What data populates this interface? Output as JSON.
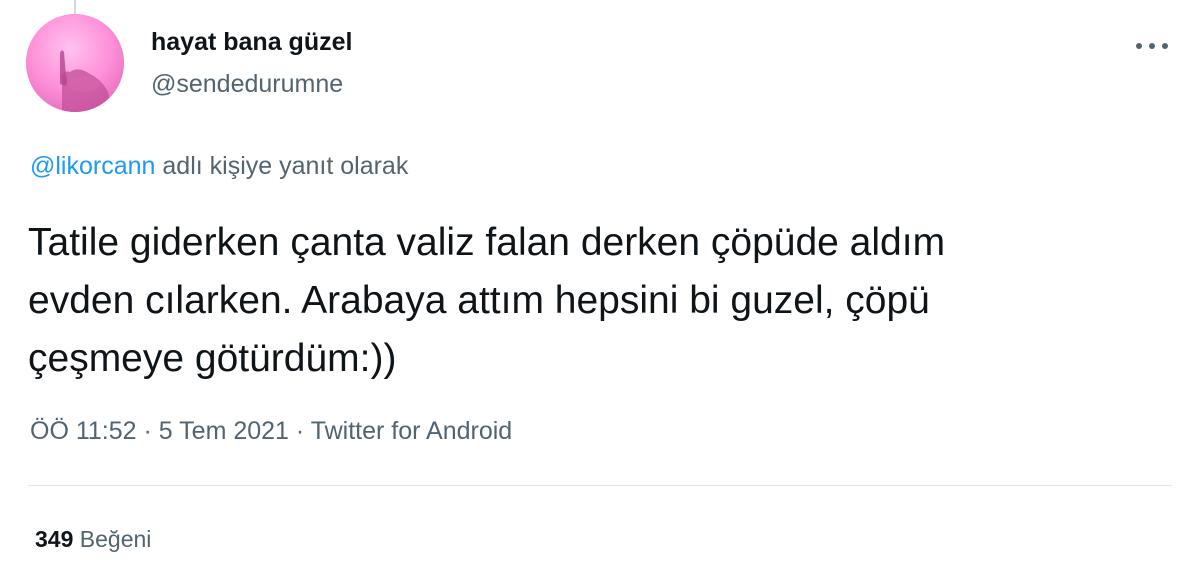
{
  "tweet": {
    "author": {
      "display_name": "hayat bana güzel",
      "handle": "@sendedurumne",
      "avatar_icon": "profile-photo-pink"
    },
    "menu_icon": "more-dots-icon",
    "reply_to": {
      "handle": "@likorcann",
      "suffix": " adlı kişiye yanıt olarak"
    },
    "text_lines": [
      "Tatile giderken çanta valiz falan derken çöpüde aldım",
      "evden cılarken. Arabaya attım hepsini bi guzel, çöpü",
      "çeşmeye götürdüm:))"
    ],
    "meta": {
      "time": "ÖÖ 11:52",
      "separator": " · ",
      "date": "5 Tem 2021",
      "source": "Twitter for Android"
    },
    "stats": {
      "likes_count": "349",
      "likes_label": " Beğeni"
    }
  },
  "colors": {
    "text_primary": "#0f1419",
    "text_secondary": "#536471",
    "link": "#1d9bf0",
    "divider": "#e1e8ed",
    "avatar_bg": "#ff8fd8"
  }
}
